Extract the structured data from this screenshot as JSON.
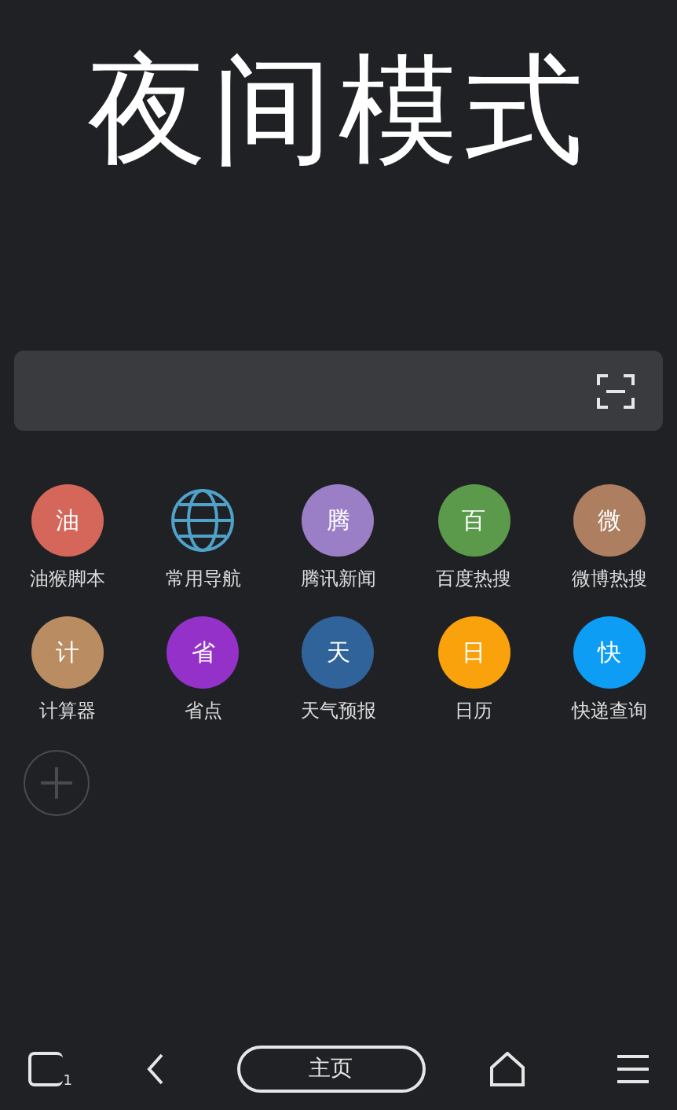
{
  "title": "夜间模式",
  "shortcuts": [
    {
      "kind": "letter",
      "glyph": "油",
      "label": "油猴脚本",
      "color": "#d4665a"
    },
    {
      "kind": "globe",
      "label": "常用导航",
      "color": "#4fa3c9"
    },
    {
      "kind": "letter",
      "glyph": "腾",
      "label": "腾讯新闻",
      "color": "#9a7fc6"
    },
    {
      "kind": "letter",
      "glyph": "百",
      "label": "百度热搜",
      "color": "#5a9a4a"
    },
    {
      "kind": "letter",
      "glyph": "微",
      "label": "微博热搜",
      "color": "#ad7e60"
    },
    {
      "kind": "letter",
      "glyph": "计",
      "label": "计算器",
      "color": "#b98c62"
    },
    {
      "kind": "letter",
      "glyph": "省",
      "label": "省点",
      "color": "#9431c9"
    },
    {
      "kind": "letter",
      "glyph": "天",
      "label": "天气预报",
      "color": "#2f6399"
    },
    {
      "kind": "letter",
      "glyph": "日",
      "label": "日历",
      "color": "#f9a20b"
    },
    {
      "kind": "letter",
      "glyph": "快",
      "label": "快递查询",
      "color": "#0d9df5"
    }
  ],
  "bottom_bar": {
    "tab_count": "1",
    "home_label": "主页"
  }
}
